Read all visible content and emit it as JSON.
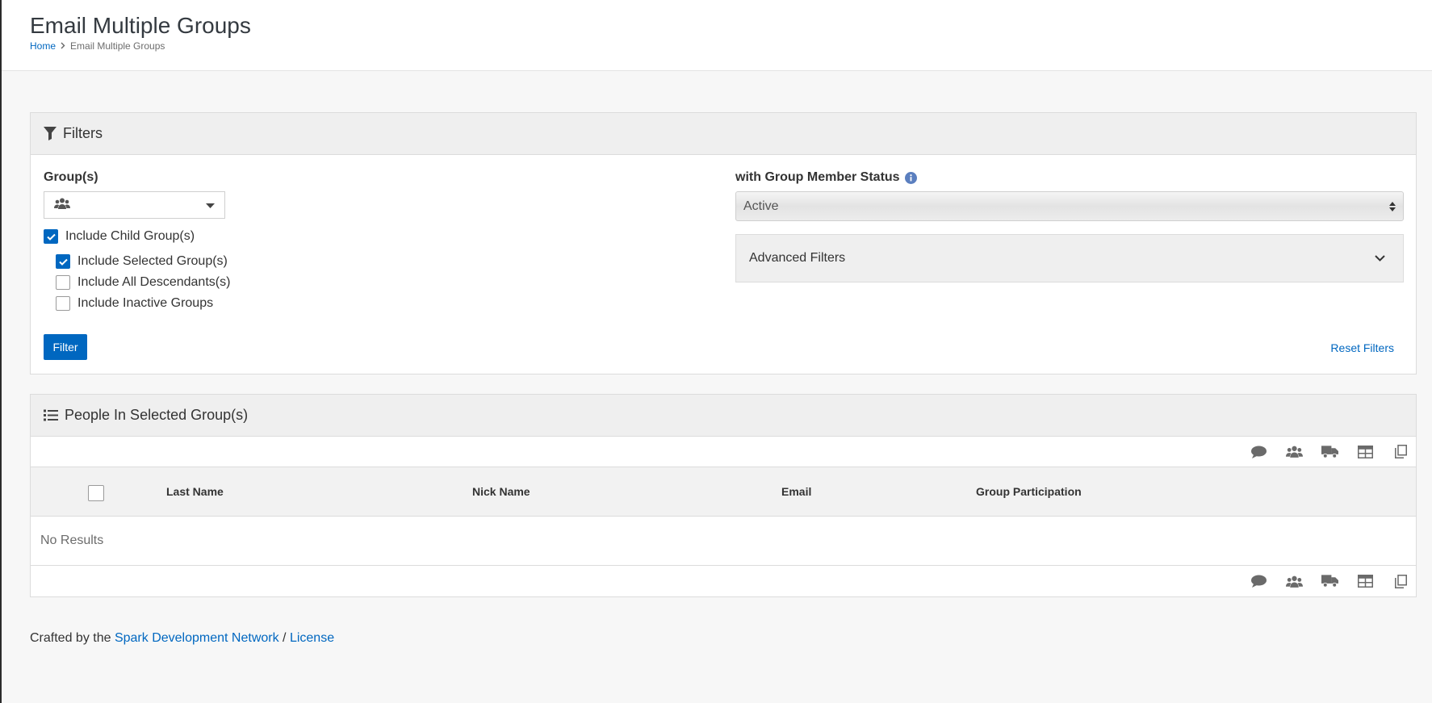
{
  "page": {
    "title": "Email Multiple Groups",
    "breadcrumb": {
      "home": "Home",
      "current": "Email Multiple Groups"
    }
  },
  "filters": {
    "heading": "Filters",
    "groups_label": "Group(s)",
    "include_child_groups": {
      "label": "Include Child Group(s)",
      "checked": true
    },
    "include_selected_groups": {
      "label": "Include Selected Group(s)",
      "checked": true
    },
    "include_all_descendants": {
      "label": "Include All Descendants(s)",
      "checked": false
    },
    "include_inactive_groups": {
      "label": "Include Inactive Groups",
      "checked": false
    },
    "filter_button": "Filter",
    "reset_link": "Reset Filters",
    "status_label": "with Group Member Status",
    "status_value": "Active",
    "advanced_label": "Advanced Filters"
  },
  "people": {
    "heading": "People In Selected Group(s)",
    "columns": [
      "Last Name",
      "Nick Name",
      "Email",
      "Group Participation"
    ],
    "empty_text": "No Results",
    "actions": [
      "communicate-icon",
      "group-icon",
      "truck-icon",
      "excel-icon",
      "merge-template-icon"
    ]
  },
  "footer": {
    "prefix": "Crafted by the",
    "link": "Spark Development Network",
    "sep": "/",
    "license": "License"
  },
  "colors": {
    "accent": "#0067c0",
    "panel_heading_bg": "#efefef",
    "page_bg": "#f7f7f7"
  }
}
